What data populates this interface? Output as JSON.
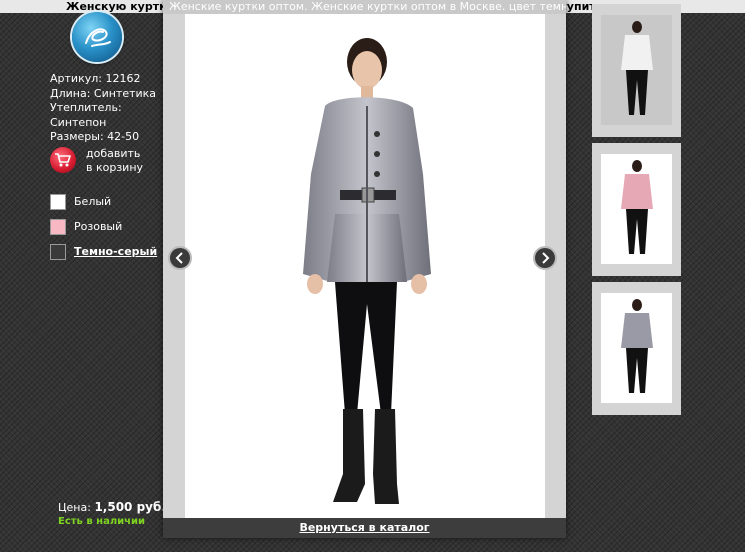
{
  "page": {
    "heading": "Женскую куртку оптом. Женские куртки оптом в Москве. цвет темно-серый купить"
  },
  "specs": [
    "Артикул: 12162",
    "Длина: Синтетика",
    "Утеплитель:",
    "Синтепон",
    "Размеры: 42-50"
  ],
  "cart": {
    "line1": "добавить",
    "line2": "в корзину"
  },
  "colors": [
    {
      "label": "Белый",
      "swatch": "#ffffff",
      "active": false
    },
    {
      "label": "Розовый",
      "swatch": "#f7b8c4",
      "active": false
    },
    {
      "label": "Темно-серый",
      "swatch": "#3a3a3a",
      "active": true
    }
  ],
  "price": {
    "label": "Цена:",
    "value": "1,500 руб."
  },
  "stock": "Есть в наличии",
  "lightbox": {
    "title": "Женские куртки оптом. Женские куртки оптом в Москве. цвет темно-серый",
    "back_link": "Вернуться в каталог"
  },
  "thumbnails": [
    {
      "jacket": "#f1f1f1",
      "bg": "#c8c8c8"
    },
    {
      "jacket": "#e6a8b4",
      "bg": "#ffffff"
    },
    {
      "jacket": "#9a9aa6",
      "bg": "#ffffff"
    }
  ]
}
